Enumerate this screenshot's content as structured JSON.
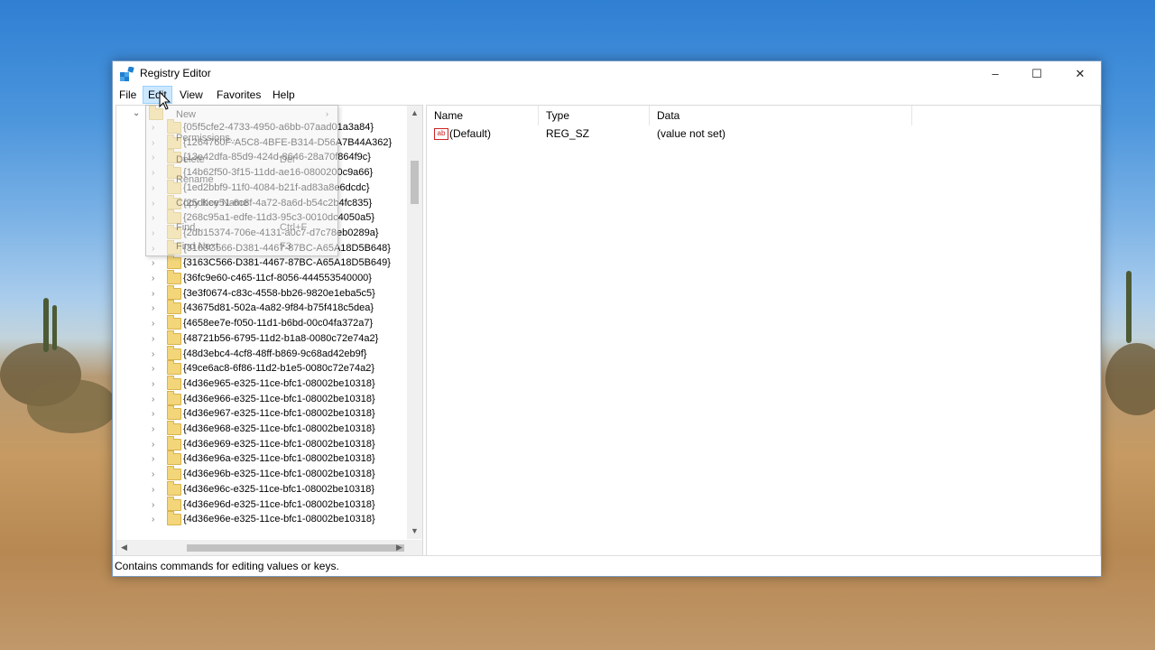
{
  "window": {
    "title": "Registry Editor",
    "minimize": "–",
    "maximize": "☐",
    "close": "✕"
  },
  "menubar": {
    "items": [
      "File",
      "Edit",
      "View",
      "Favorites",
      "Help"
    ],
    "active": "Edit"
  },
  "edit_menu": {
    "items": [
      {
        "label": "New",
        "shortcut": ""
      },
      {
        "label": "Permissions...",
        "shortcut": ""
      },
      {
        "label": "Delete",
        "shortcut": "Del"
      },
      {
        "label": "Rename",
        "shortcut": ""
      },
      {
        "label": "Copy Key Name",
        "shortcut": ""
      },
      {
        "label": "Find...",
        "shortcut": "Ctrl+F"
      },
      {
        "label": "Find Next",
        "shortcut": "F3"
      }
    ]
  },
  "tree": {
    "keys": [
      "{05f5cfe2-4733-4950-a6bb-07aad01a3a84}",
      "{1264760F-A5C8-4BFE-B314-D56A7B44A362}",
      "{13e42dfa-85d9-424d-8646-28a70f864f9c}",
      "{14b62f50-3f15-11dd-ae16-0800200c9a66}",
      "{1ed2bbf9-11f0-4084-b21f-ad83a8e6dcdc}",
      "{25dbce51-6c8f-4a72-8a6d-b54c2b4fc835}",
      "{268c95a1-edfe-11d3-95c3-0010dc4050a5}",
      "{2db15374-706e-4131-a0c7-d7c78eb0289a}",
      "{3163C566-D381-4467-87BC-A65A18D5B648}",
      "{3163C566-D381-4467-87BC-A65A18D5B649}",
      "{36fc9e60-c465-11cf-8056-444553540000}",
      "{3e3f0674-c83c-4558-bb26-9820e1eba5c5}",
      "{43675d81-502a-4a82-9f84-b75f418c5dea}",
      "{4658ee7e-f050-11d1-b6bd-00c04fa372a7}",
      "{48721b56-6795-11d2-b1a8-0080c72e74a2}",
      "{48d3ebc4-4cf8-48ff-b869-9c68ad42eb9f}",
      "{49ce6ac8-6f86-11d2-b1e5-0080c72e74a2}",
      "{4d36e965-e325-11ce-bfc1-08002be10318}",
      "{4d36e966-e325-11ce-bfc1-08002be10318}",
      "{4d36e967-e325-11ce-bfc1-08002be10318}",
      "{4d36e968-e325-11ce-bfc1-08002be10318}",
      "{4d36e969-e325-11ce-bfc1-08002be10318}",
      "{4d36e96a-e325-11ce-bfc1-08002be10318}",
      "{4d36e96b-e325-11ce-bfc1-08002be10318}",
      "{4d36e96c-e325-11ce-bfc1-08002be10318}",
      "{4d36e96d-e325-11ce-bfc1-08002be10318}",
      "{4d36e96e-e325-11ce-bfc1-08002be10318}"
    ]
  },
  "list": {
    "columns": [
      "Name",
      "Type",
      "Data"
    ],
    "rows": [
      {
        "name": "(Default)",
        "type": "REG_SZ",
        "data": "(value not set)",
        "icon": "string-value-icon"
      }
    ]
  },
  "status": {
    "text": "Contains commands for editing values or keys."
  }
}
